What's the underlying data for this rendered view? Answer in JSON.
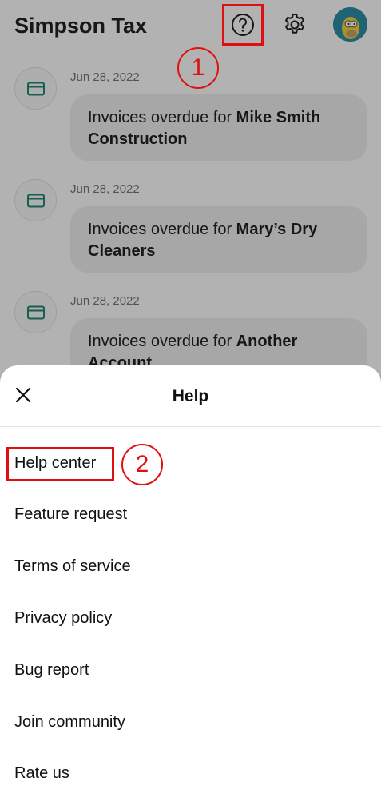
{
  "header": {
    "title": "Simpson Tax",
    "help_icon": "help-circle-icon",
    "settings_icon": "gear-icon",
    "avatar_icon": "avatar-icon"
  },
  "notifications": [
    {
      "date": "Jun 28, 2022",
      "prefix": "Invoices overdue for ",
      "name": "Mike Smith Construction",
      "icon": "card-icon"
    },
    {
      "date": "Jun 28, 2022",
      "prefix": "Invoices overdue for ",
      "name": "Mary’s Dry Cleaners",
      "icon": "card-icon"
    },
    {
      "date": "Jun 28, 2022",
      "prefix": "Invoices overdue for ",
      "name": "Another Account",
      "icon": "card-icon"
    }
  ],
  "help_sheet": {
    "title": "Help",
    "close_icon": "close-icon",
    "items": [
      "Help center",
      "Feature request",
      "Terms of service",
      "Privacy policy",
      "Bug report",
      "Join community",
      "Rate us"
    ]
  },
  "annotations": {
    "step1": "1",
    "step2": "2",
    "color": "#e01010"
  },
  "colors": {
    "accent": "#1f8a6e",
    "overlay": "rgba(0,0,0,0.30)"
  }
}
